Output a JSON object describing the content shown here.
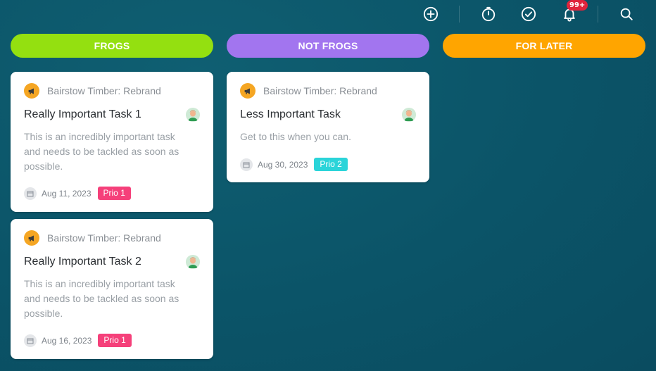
{
  "toolbar": {
    "icons": [
      "add-icon",
      "timer-icon",
      "check-icon",
      "bell-icon",
      "search-icon"
    ],
    "notifications_badge": "99+"
  },
  "columns": [
    {
      "title": "FROGS",
      "color": "#94e010",
      "cards": [
        {
          "project": "Bairstow Timber: Rebrand",
          "title": "Really Important Task 1",
          "description": "This is an incredibly important task and needs to be tackled as soon as possible.",
          "date": "Aug 11, 2023",
          "priority": "Prio 1",
          "priority_color": "#f5407a"
        },
        {
          "project": "Bairstow Timber: Rebrand",
          "title": "Really Important Task 2",
          "description": "This is an incredibly important task and needs to be tackled as soon as possible.",
          "date": "Aug 16, 2023",
          "priority": "Prio 1",
          "priority_color": "#f5407a"
        }
      ]
    },
    {
      "title": "NOT FROGS",
      "color": "#a275ef",
      "cards": [
        {
          "project": "Bairstow Timber: Rebrand",
          "title": "Less Important Task",
          "description": "Get to this when you can.",
          "date": "Aug 30, 2023",
          "priority": "Prio 2",
          "priority_color": "#2bd4d9"
        }
      ]
    },
    {
      "title": "FOR LATER",
      "color": "#ffa500",
      "cards": []
    }
  ]
}
